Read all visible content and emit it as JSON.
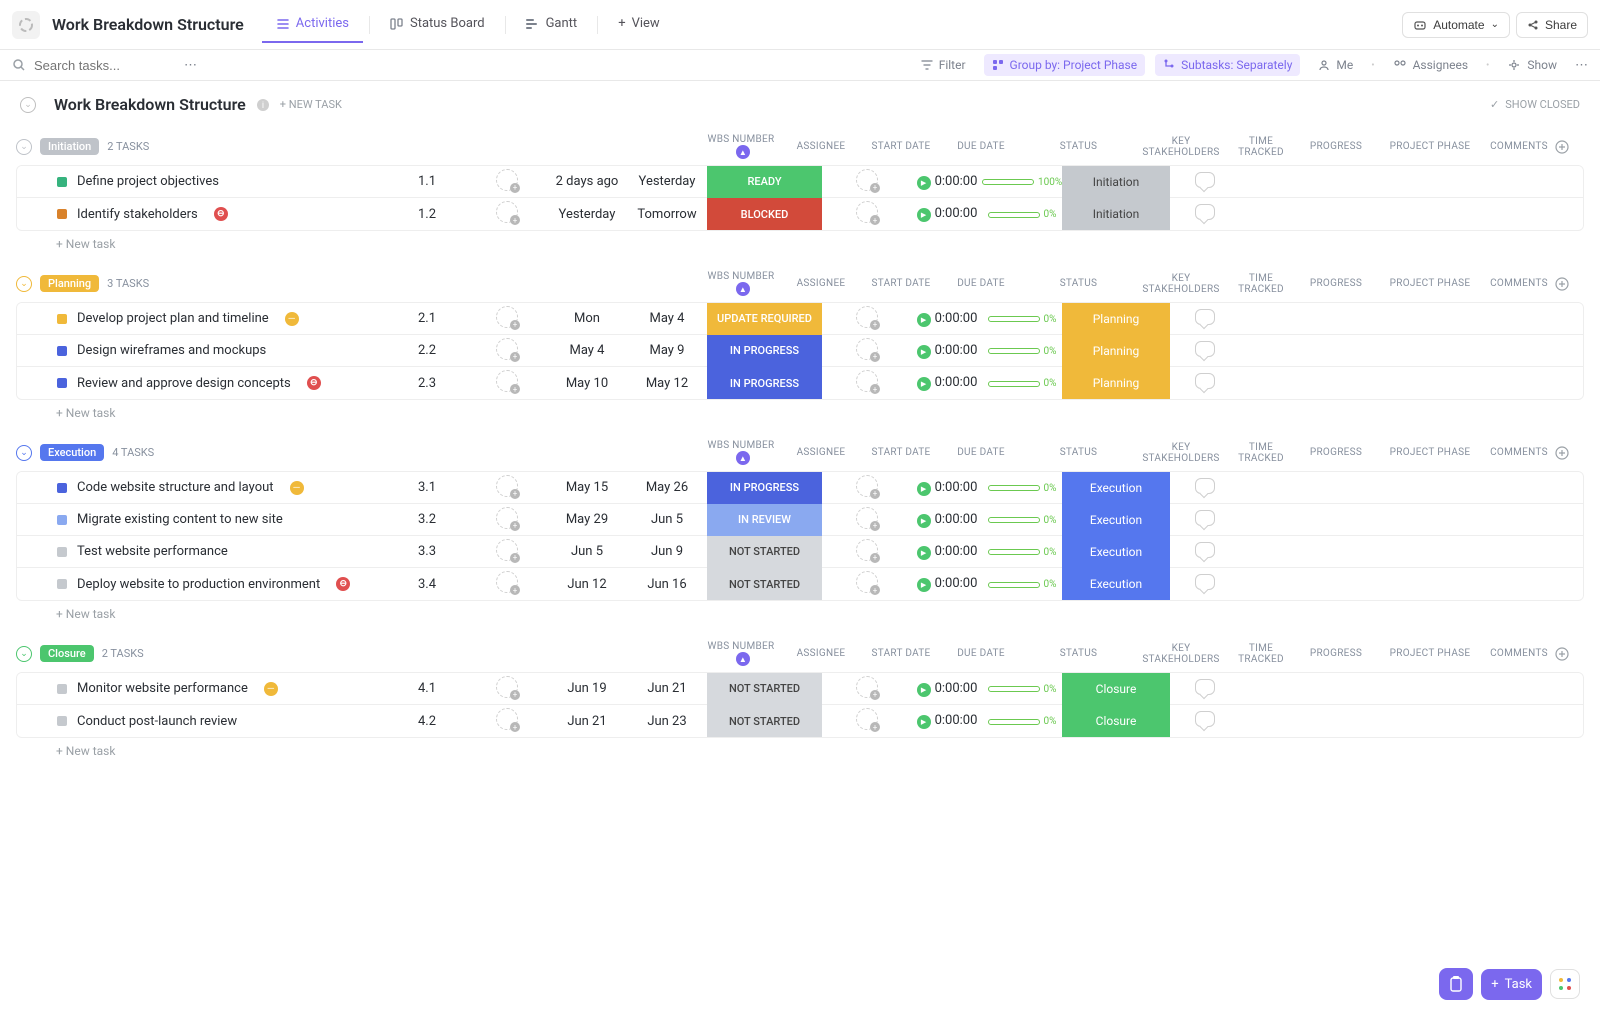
{
  "page_title": "Work Breakdown Structure",
  "views": [
    {
      "label": "Activities",
      "icon": "list-icon",
      "active": true
    },
    {
      "label": "Status Board",
      "icon": "board-icon"
    },
    {
      "label": "Gantt",
      "icon": "gantt-icon"
    },
    {
      "label": "View",
      "icon": "plus-icon"
    }
  ],
  "top_actions": {
    "automate": "Automate",
    "share": "Share"
  },
  "toolbar": {
    "search_placeholder": "Search tasks...",
    "filter": "Filter",
    "group_by": "Group by: Project Phase",
    "subtasks": "Subtasks: Separately",
    "me": "Me",
    "assignees": "Assignees",
    "show": "Show"
  },
  "list_header": {
    "title": "Work Breakdown Structure",
    "new_task": "+ NEW TASK",
    "show_closed": "SHOW CLOSED"
  },
  "columns": {
    "wbs": "WBS NUMBER",
    "assignee": "ASSIGNEE",
    "start": "START DATE",
    "due": "DUE DATE",
    "status": "STATUS",
    "stake": "KEY STAKEHOLDERS",
    "time": "TIME TRACKED",
    "progress": "PROGRESS",
    "phase": "PROJECT PHASE",
    "comments": "COMMENTS"
  },
  "new_task_label": "+ New task",
  "colors": {
    "initiation": "#bfc3c9",
    "planning": "#f0b93a",
    "execution": "#5577ee",
    "closure": "#4cc66e",
    "ready": "#4cc66e",
    "blocked": "#d24a3a",
    "update_required": "#f0b93a",
    "in_progress": "#4b63dd",
    "in_review": "#8aa9f0",
    "not_started": "#d6d9dd",
    "phase_initiation": "#c5c9ce",
    "phase_planning": "#f0b93a",
    "phase_execution": "#5577ee",
    "phase_closure": "#4cc66e",
    "sq_green": "#36b37e",
    "sq_orange": "#d9822b",
    "sq_yellow": "#f0b93a",
    "sq_blue": "#4b63dd",
    "sq_lightblue": "#8aa9f0",
    "sq_gray": "#c5c9ce"
  },
  "groups": [
    {
      "name": "Initiation",
      "color_key": "initiation",
      "toggle_color": "#bfc3c9",
      "count": "2 TASKS",
      "tasks": [
        {
          "name": "Define project objectives",
          "sq": "sq_green",
          "wbs": "1.1",
          "start": "2 days ago",
          "due": "Yesterday",
          "status": "READY",
          "status_key": "ready",
          "time": "0:00:00",
          "progress": 100,
          "progress_label": "100%",
          "phase": "Initiation",
          "phase_key": "phase_initiation",
          "phase_text_color": "#444",
          "flag": null
        },
        {
          "name": "Identify stakeholders",
          "sq": "sq_orange",
          "wbs": "1.2",
          "start": "Yesterday",
          "due": "Tomorrow",
          "status": "BLOCKED",
          "status_key": "blocked",
          "time": "0:00:00",
          "progress": 0,
          "progress_label": "0%",
          "phase": "Initiation",
          "phase_key": "phase_initiation",
          "phase_text_color": "#444",
          "flag": "red"
        }
      ]
    },
    {
      "name": "Planning",
      "color_key": "planning",
      "toggle_color": "#f0b93a",
      "count": "3 TASKS",
      "tasks": [
        {
          "name": "Develop project plan and timeline",
          "sq": "sq_yellow",
          "wbs": "2.1",
          "start": "Mon",
          "due": "May 4",
          "status": "UPDATE REQUIRED",
          "status_key": "update_required",
          "time": "0:00:00",
          "progress": 0,
          "progress_label": "0%",
          "phase": "Planning",
          "phase_key": "phase_planning",
          "phase_text_color": "#fff",
          "flag": "yellow"
        },
        {
          "name": "Design wireframes and mockups",
          "sq": "sq_blue",
          "wbs": "2.2",
          "start": "May 4",
          "due": "May 9",
          "status": "IN PROGRESS",
          "status_key": "in_progress",
          "time": "0:00:00",
          "progress": 0,
          "progress_label": "0%",
          "phase": "Planning",
          "phase_key": "phase_planning",
          "phase_text_color": "#fff",
          "flag": null
        },
        {
          "name": "Review and approve design concepts",
          "sq": "sq_blue",
          "wbs": "2.3",
          "start": "May 10",
          "due": "May 12",
          "status": "IN PROGRESS",
          "status_key": "in_progress",
          "time": "0:00:00",
          "progress": 0,
          "progress_label": "0%",
          "phase": "Planning",
          "phase_key": "phase_planning",
          "phase_text_color": "#fff",
          "flag": "red"
        }
      ]
    },
    {
      "name": "Execution",
      "color_key": "execution",
      "toggle_color": "#5577ee",
      "count": "4 TASKS",
      "tasks": [
        {
          "name": "Code website structure and layout",
          "sq": "sq_blue",
          "wbs": "3.1",
          "start": "May 15",
          "due": "May 26",
          "status": "IN PROGRESS",
          "status_key": "in_progress",
          "time": "0:00:00",
          "progress": 0,
          "progress_label": "0%",
          "phase": "Execution",
          "phase_key": "phase_execution",
          "phase_text_color": "#fff",
          "flag": "yellow"
        },
        {
          "name": "Migrate existing content to new site",
          "sq": "sq_lightblue",
          "wbs": "3.2",
          "start": "May 29",
          "due": "Jun 5",
          "status": "IN REVIEW",
          "status_key": "in_review",
          "time": "0:00:00",
          "progress": 0,
          "progress_label": "0%",
          "phase": "Execution",
          "phase_key": "phase_execution",
          "phase_text_color": "#fff",
          "flag": null
        },
        {
          "name": "Test website performance",
          "sq": "sq_gray",
          "wbs": "3.3",
          "start": "Jun 5",
          "due": "Jun 9",
          "status": "NOT STARTED",
          "status_key": "not_started",
          "status_text_color": "#444",
          "time": "0:00:00",
          "progress": 0,
          "progress_label": "0%",
          "phase": "Execution",
          "phase_key": "phase_execution",
          "phase_text_color": "#fff",
          "flag": null
        },
        {
          "name": "Deploy website to production environment",
          "sq": "sq_gray",
          "wbs": "3.4",
          "start": "Jun 12",
          "due": "Jun 16",
          "status": "NOT STARTED",
          "status_key": "not_started",
          "status_text_color": "#444",
          "time": "0:00:00",
          "progress": 0,
          "progress_label": "0%",
          "phase": "Execution",
          "phase_key": "phase_execution",
          "phase_text_color": "#fff",
          "flag": "red"
        }
      ]
    },
    {
      "name": "Closure",
      "color_key": "closure",
      "toggle_color": "#4cc66e",
      "count": "2 TASKS",
      "tasks": [
        {
          "name": "Monitor website performance",
          "sq": "sq_gray",
          "wbs": "4.1",
          "start": "Jun 19",
          "due": "Jun 21",
          "status": "NOT STARTED",
          "status_key": "not_started",
          "status_text_color": "#444",
          "time": "0:00:00",
          "progress": 0,
          "progress_label": "0%",
          "phase": "Closure",
          "phase_key": "phase_closure",
          "phase_text_color": "#fff",
          "flag": "yellow"
        },
        {
          "name": "Conduct post-launch review",
          "sq": "sq_gray",
          "wbs": "4.2",
          "start": "Jun 21",
          "due": "Jun 23",
          "status": "NOT STARTED",
          "status_key": "not_started",
          "status_text_color": "#444",
          "time": "0:00:00",
          "progress": 0,
          "progress_label": "0%",
          "phase": "Closure",
          "phase_key": "phase_closure",
          "phase_text_color": "#fff",
          "flag": null
        }
      ]
    }
  ],
  "fab": {
    "task": "Task"
  }
}
